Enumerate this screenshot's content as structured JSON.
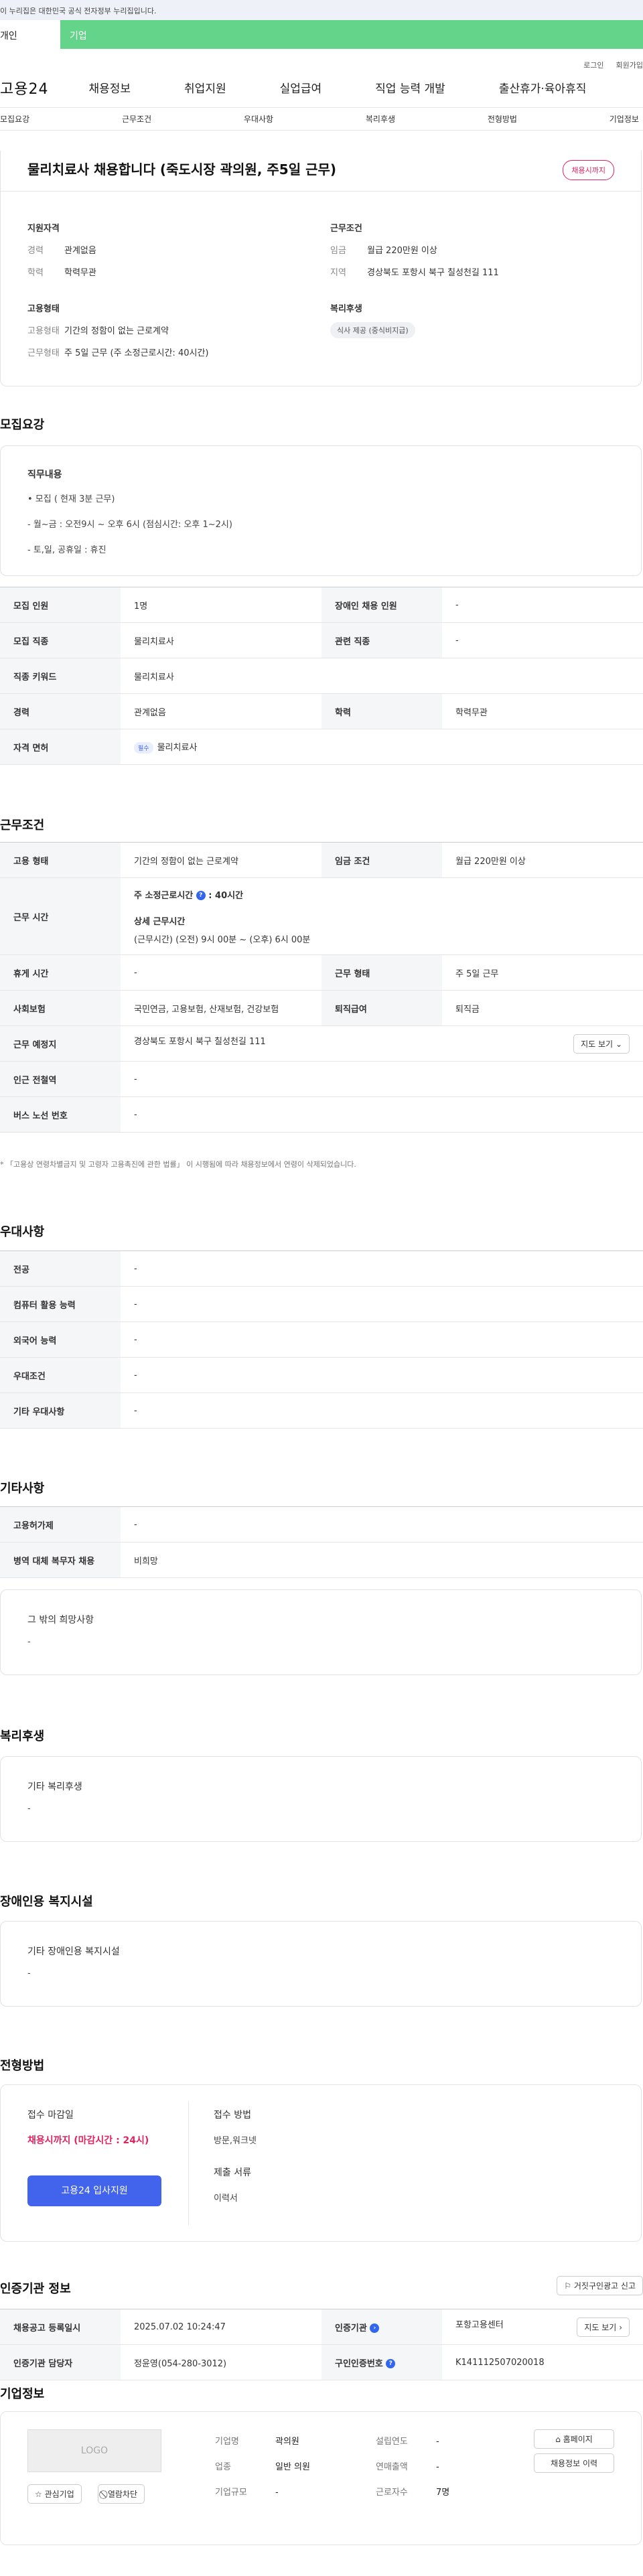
{
  "gov_notice": "이 누리집은 대한민국 공식 전자정부 누리집입니다.",
  "tabs": {
    "individual": "개인",
    "business": "기업"
  },
  "util": {
    "login": "로그인",
    "join": "회원가입"
  },
  "gnb": {
    "logo": "고용24",
    "items": [
      "채용정보",
      "취업지원",
      "실업급여",
      "직업 능력 개발",
      "출산휴가·육아휴직"
    ]
  },
  "subnav": [
    "모집요강",
    "근무조건",
    "우대사항",
    "복리후생",
    "전형방법",
    "기업정보"
  ],
  "summary": {
    "title": "물리치료사 채용합니다 (죽도시장 곽의원, 주5일 근무)",
    "badge": "채용시까지",
    "qual_head": "지원자격",
    "qual": [
      {
        "k": "경력",
        "v": "관계없음"
      },
      {
        "k": "학력",
        "v": "학력무관"
      }
    ],
    "cond_head": "근무조건",
    "cond": [
      {
        "k": "임금",
        "v": "월급 220만원 이상"
      },
      {
        "k": "지역",
        "v": "경상북도 포항시 북구 칠성천길 111"
      }
    ],
    "emp_head": "고용형태",
    "emp": [
      {
        "k": "고용형태",
        "v": "기간의 정함이 없는 근로계약"
      },
      {
        "k": "근무형태",
        "v": "주 5일 근무 (주 소정근로시간: 40시간)"
      }
    ],
    "welfare_head": "복리후생",
    "welfare_chip": "식사 제공 (중식비지급)"
  },
  "recruit": {
    "section_title": "모집요강",
    "duty_head": "직무내용",
    "duty_lines": [
      "• 모집 ( 현재 3분 근무)",
      "- 월~금 :  오전9시 ~ 오후 6시 (점심시간: 오후 1~2시)",
      "- 토,일, 공휴일 :  휴진"
    ],
    "rows": {
      "headcount_k": "모집 인원",
      "headcount_v": "1명",
      "disabled_k": "장애인 채용 인원",
      "disabled_v": "-",
      "job_k": "모집 직종",
      "job_v": "물리치료사",
      "related_k": "관련 직종",
      "related_v": "-",
      "keyword_k": "직종 키워드",
      "keyword_v": "물리치료사",
      "career_k": "경력",
      "career_v": "관계없음",
      "edu_k": "학력",
      "edu_v": "학력무관",
      "license_k": "자격 면허",
      "license_tag": "필수",
      "license_v": "물리치료사"
    }
  },
  "work": {
    "section_title": "근무조건",
    "emptype_k": "고용 형태",
    "emptype_v": "기간의 정함이 없는 근로계약",
    "wage_k": "임금 조건",
    "wage_v": "월급 220만원 이상",
    "hours_k": "근무 시간",
    "hours_std_label": "주 소정근로시간",
    "hours_std_v": "40시간",
    "hours_detail_label": "상세 근무시간",
    "hours_detail_v": "(근무시간) (오전) 9시 00분 ~ (오후) 6시 00분",
    "rest_k": "휴게 시간",
    "rest_v": "-",
    "shift_k": "근무 형태",
    "shift_v": "주 5일 근무",
    "insurance_k": "사회보험",
    "insurance_v": "국민연금, 고용보험, 산재보험, 건강보험",
    "severance_k": "퇴직급여",
    "severance_v": "퇴직금",
    "place_k": "근무 예정지",
    "place_v": "경상북도 포항시 북구 칠성천길 111",
    "map_btn": "지도 보기",
    "subway_k": "인근 전철역",
    "subway_v": "-",
    "bus_k": "버스 노선 번호",
    "bus_v": "-",
    "note": "* 「고용상 연령차별금지 및 고령자 고용촉진에 관한 법률」 이 시행됨에 따라 채용정보에서 연령이 삭제되었습니다."
  },
  "pref": {
    "section_title": "우대사항",
    "rows": [
      {
        "k": "전공",
        "v": "-"
      },
      {
        "k": "컴퓨터 활용 능력",
        "v": "-"
      },
      {
        "k": "외국어 능력",
        "v": "-"
      },
      {
        "k": "우대조건",
        "v": "-"
      },
      {
        "k": "기타 우대사항",
        "v": "-"
      }
    ]
  },
  "etc": {
    "section_title": "기타사항",
    "rows": [
      {
        "k": "고용허가제",
        "v": "-"
      },
      {
        "k": "병역 대체 복무자 채용",
        "v": "비희망"
      }
    ],
    "other_head": "그 밖의 희망사항",
    "other_v": "-"
  },
  "welfare": {
    "section_title": "복리후생",
    "head": "기타 복리후생",
    "v": "-"
  },
  "disability": {
    "section_title": "장애인용 복지시설",
    "head": "기타 장애인용 복지시설",
    "v": "-"
  },
  "selection": {
    "section_title": "전형방법",
    "deadline_head": "접수 마감일",
    "deadline_v": "채용시까지 (마감시간 : 24시)",
    "apply_btn": "고용24 입사지원",
    "method_head": "접수 방법",
    "method_v": "방문,워크넷",
    "docs_head": "제출 서류",
    "docs_v": "이력서"
  },
  "agency": {
    "section_title": "인증기관 정보",
    "report_btn": "거짓구인광고 신고",
    "reg_date_k": "채용공고 등록일시",
    "reg_date_v": "2025.07.02 10:24:47",
    "org_k": "인증기관",
    "org_v": "포항고용센터",
    "map_btn": "지도 보기",
    "manager_k": "인증기관 담당자",
    "manager_v": "정윤영(054-280-3012)",
    "reqno_k": "구인인증번호",
    "reqno_v": "K141112507020018"
  },
  "company": {
    "section_title": "기업정보",
    "logo": "LOGO",
    "interest_btn": "관심기업",
    "block_btn": "열람차단",
    "name_k": "기업명",
    "name_v": "곽의원",
    "found_k": "설립연도",
    "found_v": "-",
    "biz_k": "업종",
    "biz_v": "일반 의원",
    "revenue_k": "연매출액",
    "revenue_v": "-",
    "scale_k": "기업규모",
    "scale_v": "-",
    "workers_k": "근로자수",
    "workers_v": "7명",
    "homepage_btn": "홈페이지",
    "jobs_btn": "채용정보 이력"
  }
}
